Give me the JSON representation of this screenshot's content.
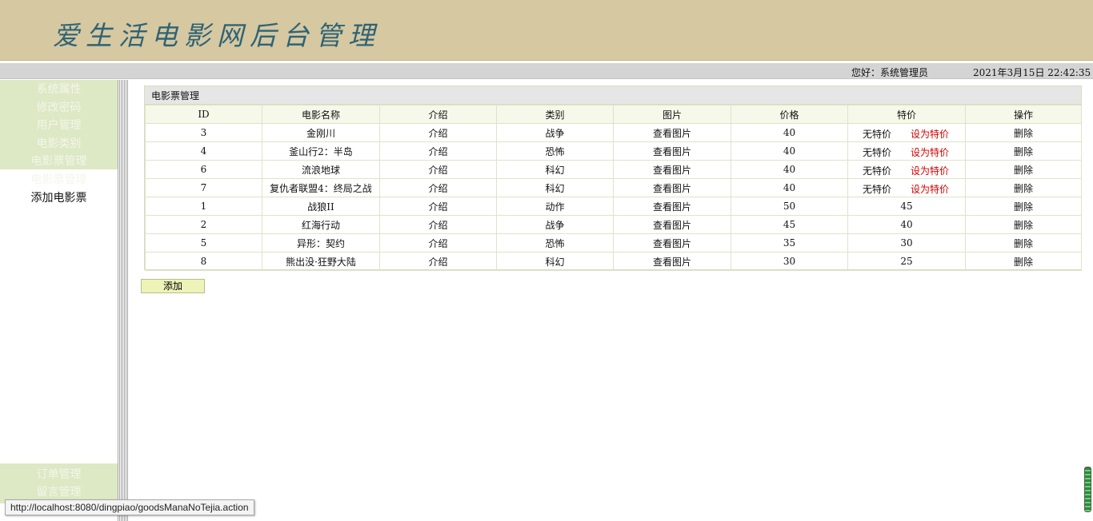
{
  "header": {
    "title": "爱生活电影网后台管理"
  },
  "topbar": {
    "greeting": "您好：系统管理员",
    "datetime": "2021年3月15日 22:42:35"
  },
  "sidebar": {
    "items": [
      {
        "label": "系统属性"
      },
      {
        "label": "修改密码"
      },
      {
        "label": "用户管理"
      },
      {
        "label": "电影类别"
      },
      {
        "label": "电影票管理"
      },
      {
        "label": "电影票管理"
      },
      {
        "label": "添加电影票"
      }
    ],
    "bottom_items": [
      {
        "label": "订单管理"
      },
      {
        "label": "留言管理"
      }
    ]
  },
  "panel": {
    "title": "电影票管理"
  },
  "table": {
    "headers": [
      "ID",
      "电影名称",
      "介绍",
      "类别",
      "图片",
      "价格",
      "特价",
      "操作"
    ],
    "rows": [
      {
        "id": "3",
        "name": "金刚川",
        "intro": "介绍",
        "category": "战争",
        "image": "查看图片",
        "price": "40",
        "special_text": "无特价",
        "special_action": "设为特价",
        "special_price": "",
        "op": "删除"
      },
      {
        "id": "4",
        "name": "釜山行2：半岛",
        "intro": "介绍",
        "category": "恐怖",
        "image": "查看图片",
        "price": "40",
        "special_text": "无特价",
        "special_action": "设为特价",
        "special_price": "",
        "op": "删除"
      },
      {
        "id": "6",
        "name": "流浪地球",
        "intro": "介绍",
        "category": "科幻",
        "image": "查看图片",
        "price": "40",
        "special_text": "无特价",
        "special_action": "设为特价",
        "special_price": "",
        "op": "删除"
      },
      {
        "id": "7",
        "name": "复仇者联盟4：终局之战",
        "intro": "介绍",
        "category": "科幻",
        "image": "查看图片",
        "price": "40",
        "special_text": "无特价",
        "special_action": "设为特价",
        "special_price": "",
        "op": "删除"
      },
      {
        "id": "1",
        "name": "战狼II",
        "intro": "介绍",
        "category": "动作",
        "image": "查看图片",
        "price": "50",
        "special_text": "",
        "special_action": "",
        "special_price": "45",
        "op": "删除"
      },
      {
        "id": "2",
        "name": "红海行动",
        "intro": "介绍",
        "category": "战争",
        "image": "查看图片",
        "price": "45",
        "special_text": "",
        "special_action": "",
        "special_price": "40",
        "op": "删除"
      },
      {
        "id": "5",
        "name": "异形：契约",
        "intro": "介绍",
        "category": "恐怖",
        "image": "查看图片",
        "price": "35",
        "special_text": "",
        "special_action": "",
        "special_price": "30",
        "op": "删除"
      },
      {
        "id": "8",
        "name": "熊出没·狂野大陆",
        "intro": "介绍",
        "category": "科幻",
        "image": "查看图片",
        "price": "30",
        "special_text": "",
        "special_action": "",
        "special_price": "25",
        "op": "删除"
      }
    ]
  },
  "add_button": {
    "label": "添加"
  },
  "status_bar": {
    "url": "http://localhost:8080/dingpiao/goodsManaNoTejia.action"
  },
  "colors": {
    "header_bg": "#d6c8a0",
    "title": "#2f6376",
    "menu_bg": "#dde8c4",
    "special_link": "#d40000"
  }
}
